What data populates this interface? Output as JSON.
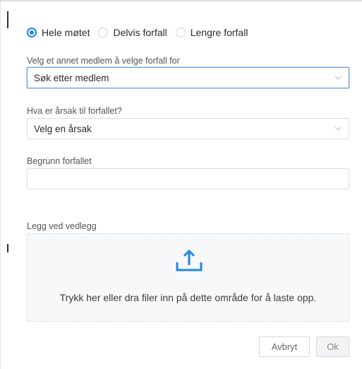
{
  "absence_type": {
    "options": [
      "Hele møtet",
      "Delvis forfall",
      "Lengre forfall"
    ],
    "selected": "Hele møtet"
  },
  "member": {
    "label": "Velg et annet medlem å velge forfall for",
    "value": "Søk etter medlem",
    "icon": "chevron-down-icon"
  },
  "reason": {
    "label": "Hva er årsak til forfallet?",
    "value": "Velg en årsak",
    "icon": "chevron-down-icon"
  },
  "justification": {
    "label": "Begrunn forfallet",
    "value": ""
  },
  "attachment": {
    "label": "Legg ved vedlegg",
    "dropzone_text": "Trykk her eller dra filer inn på dette område for å laste opp.",
    "icon": "upload-icon"
  },
  "actions": {
    "cancel_label": "Avbryt",
    "ok_label": "Ok"
  },
  "colors": {
    "accent": "#1e88e5",
    "focus_border": "#5b9bd8",
    "dropzone_bg": "#f7f8fa"
  }
}
